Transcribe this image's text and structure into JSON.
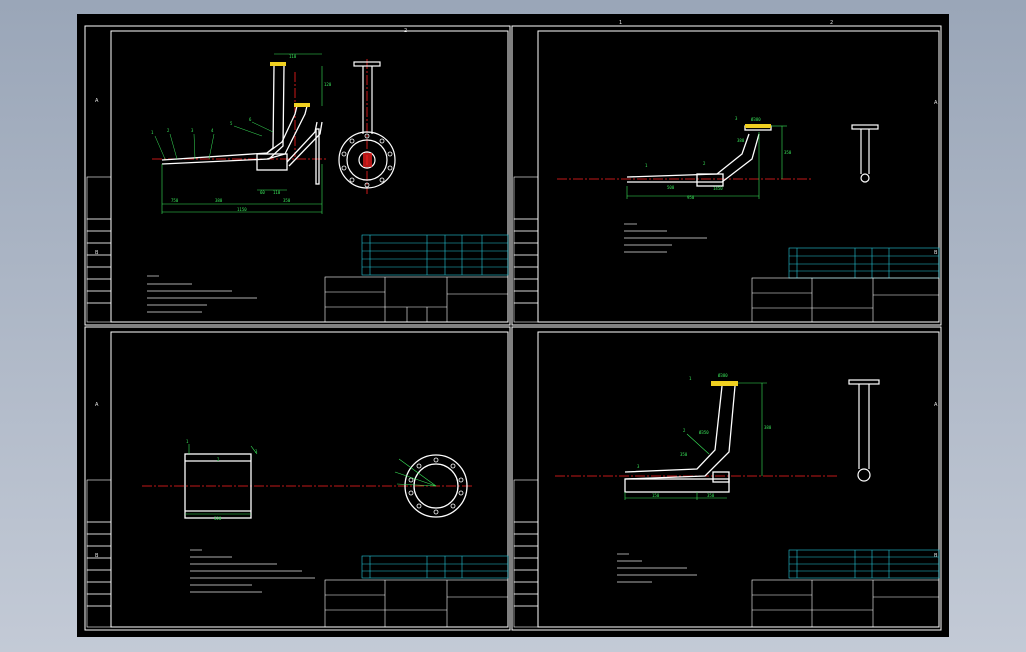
{
  "colors": {
    "background": "#000000",
    "frame": "#ffffff",
    "part": "#ffffff",
    "centerline": "#ff2020",
    "dimension": "#39e65a",
    "table_lines": "#25c7d9",
    "flange_highlight": "#f0d020"
  },
  "sheet1": {
    "border_letters": [
      "A",
      "B"
    ],
    "top_mark": "2",
    "dims": [
      "110",
      "120",
      "750",
      "380",
      "1150",
      "60",
      "110",
      "350"
    ],
    "callouts": [
      "1",
      "2",
      "3",
      "4",
      "5",
      "6"
    ]
  },
  "sheet2": {
    "top_marks": [
      "1",
      "2"
    ],
    "border_letters": [
      "A",
      "B"
    ],
    "dims": [
      "Ø380",
      "380",
      "500",
      "950",
      "1450",
      "350"
    ],
    "callouts": [
      "1",
      "2",
      "3"
    ]
  },
  "sheet3": {
    "border_letters": [
      "A",
      "B"
    ],
    "dims": [
      "320"
    ],
    "callouts": [
      "1",
      "2",
      "3"
    ]
  },
  "sheet4": {
    "border_letters": [
      "A",
      "B"
    ],
    "dims": [
      "Ø380",
      "Ø350",
      "350",
      "380",
      "150",
      "350"
    ],
    "callouts": [
      "1",
      "2",
      "3"
    ]
  }
}
